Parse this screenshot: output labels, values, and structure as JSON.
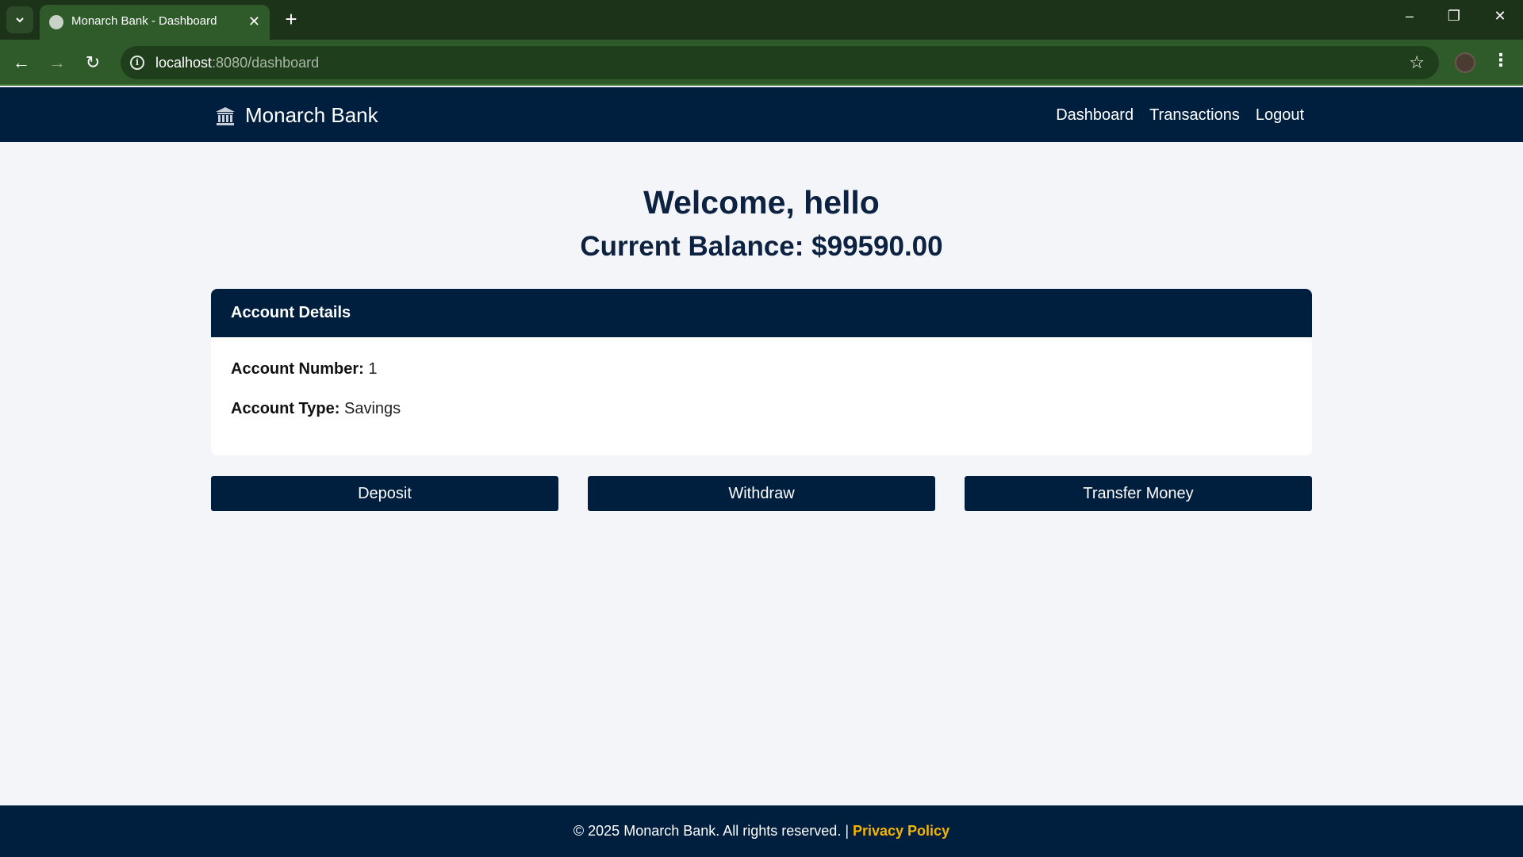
{
  "browser": {
    "tab_title": "Monarch Bank - Dashboard",
    "url_host": "localhost",
    "url_rest": ":8080/dashboard"
  },
  "nav": {
    "brand": "Monarch Bank",
    "links": [
      "Dashboard",
      "Transactions",
      "Logout"
    ]
  },
  "main": {
    "welcome": "Welcome, hello",
    "balance": "Current Balance: $99590.00"
  },
  "account": {
    "header": "Account Details",
    "number_label": "Account Number:",
    "number_value": "1",
    "type_label": "Account Type:",
    "type_value": "Savings"
  },
  "actions": [
    "Deposit",
    "Withdraw",
    "Transfer Money"
  ],
  "footer": {
    "text": "© 2025 Monarch Bank. All rights reserved. | ",
    "privacy": "Privacy Policy"
  },
  "colors": {
    "navy": "#001f3f",
    "accent": "#f5b400",
    "browser_frame": "#2f5a2a"
  }
}
